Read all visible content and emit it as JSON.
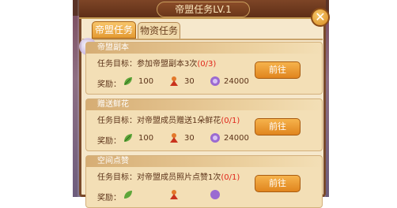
{
  "dialog": {
    "title": "帝盟任务LV.1",
    "close": "✕"
  },
  "tabs": [
    {
      "label": "帝盟任务",
      "active": true
    },
    {
      "label": "物资任务",
      "active": false
    }
  ],
  "tasks": [
    {
      "name": "帝盟副本",
      "goal_prefix": "任务目标：",
      "goal": "参加帝盟副本3次",
      "progress": "(0/3)",
      "reward_label": "奖励：",
      "reward_1": "100",
      "reward_2": "30",
      "reward_3": "24000",
      "button": "前往"
    },
    {
      "name": "赠送鲜花",
      "goal_prefix": "任务目标：",
      "goal": "对帝盟成员赠送1朵鲜花",
      "progress": "(0/1)",
      "reward_label": "奖励：",
      "reward_1": "100",
      "reward_2": "30",
      "reward_3": "24000",
      "button": "前往"
    },
    {
      "name": "空间点赞",
      "goal_prefix": "任务目标：",
      "goal": "对帝盟成员照片点赞1次",
      "progress": "(0/1)",
      "reward_label": "奖励：",
      "reward_1": "",
      "reward_2": "",
      "reward_3": "",
      "button": "前往"
    }
  ],
  "icons": {
    "reward_1": "green-leaf-icon",
    "reward_2": "red-figure-icon",
    "reward_3": "purple-gem-icon"
  },
  "colors": {
    "accent": "#e0851e",
    "progress": "#e0261a",
    "panel": "#f6e8cc",
    "frame": "#7a4a2a"
  }
}
